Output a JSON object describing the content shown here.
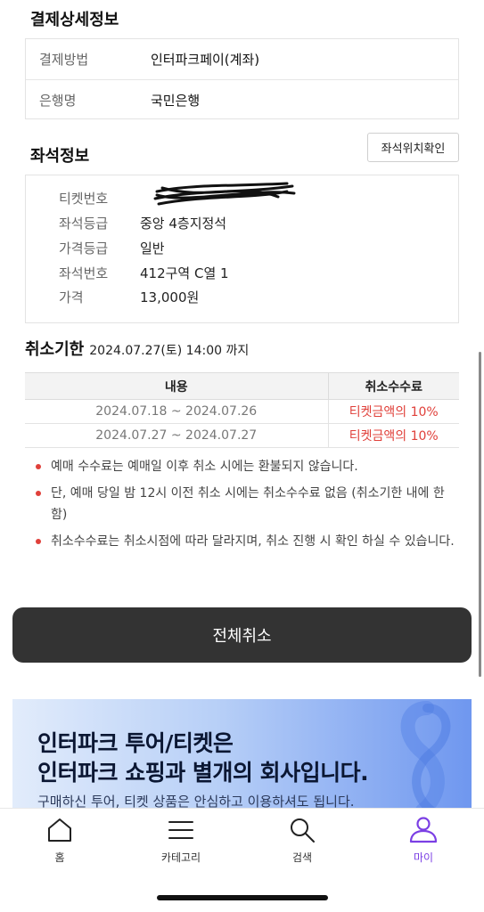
{
  "payment": {
    "title": "결제상세정보",
    "rows": [
      {
        "label": "결제방법",
        "value": "인터파크페이(계좌)"
      },
      {
        "label": "은행명",
        "value": "국민은행"
      }
    ]
  },
  "seat": {
    "title": "좌석정보",
    "check_button": "좌석위치확인",
    "rows": [
      {
        "label": "티켓번호",
        "value": ""
      },
      {
        "label": "좌석등급",
        "value": "중앙 4층지정석"
      },
      {
        "label": "가격등급",
        "value": "일반"
      },
      {
        "label": "좌석번호",
        "value": "412구역 C열 1"
      },
      {
        "label": "가격",
        "value": "13,000원"
      }
    ]
  },
  "cancel": {
    "title": "취소기한",
    "deadline": "2024.07.27(토) 14:00 까지",
    "table": {
      "headers": [
        "내용",
        "취소수수료"
      ],
      "rows": [
        [
          "2024.07.18 ~ 2024.07.26",
          "티켓금액의 10%"
        ],
        [
          "2024.07.27 ~ 2024.07.27",
          "티켓금액의 10%"
        ]
      ]
    },
    "notes": [
      "예매 수수료는 예매일 이후 취소 시에는 환불되지 않습니다.",
      "단, 예매 당일 밤 12시 이전 취소 시에는 취소수수료 없음 (취소기한 내에 한함)",
      "취소수수료는 취소시점에 따라 달라지며, 취소 진행 시 확인 하실 수 있습니다."
    ],
    "cancel_all_button": "전체취소"
  },
  "banner": {
    "line1": "인터파크 투어/티켓은",
    "line2": "인터파크 쇼핑과 별개의 회사입니다.",
    "line3": "구매하신 투어, 티켓 상품은 안심하고 이용하셔도 됩니다."
  },
  "tabbar": {
    "items": [
      {
        "label": "홈",
        "icon": "home-icon"
      },
      {
        "label": "카테고리",
        "icon": "menu-icon"
      },
      {
        "label": "검색",
        "icon": "search-icon"
      },
      {
        "label": "마이",
        "icon": "person-icon"
      }
    ],
    "active_color": "#7b3fe4"
  },
  "colors": {
    "accent_red": "#e0403a",
    "button_dark": "#333333"
  }
}
